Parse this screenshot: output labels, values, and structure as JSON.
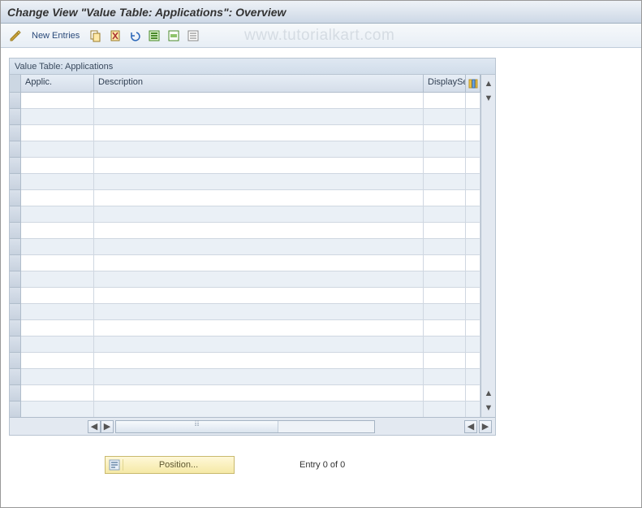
{
  "header": {
    "title": "Change View \"Value Table: Applications\": Overview"
  },
  "toolbar": {
    "new_entries_label": "New Entries"
  },
  "watermark": "www.tutorialkart.com",
  "table": {
    "caption": "Value Table: Applications",
    "columns": {
      "applic": "Applic.",
      "description": "Description",
      "displayseq": "DisplaySe"
    },
    "row_count": 20
  },
  "footer": {
    "position_label": "Position...",
    "entry_status": "Entry 0 of 0"
  }
}
